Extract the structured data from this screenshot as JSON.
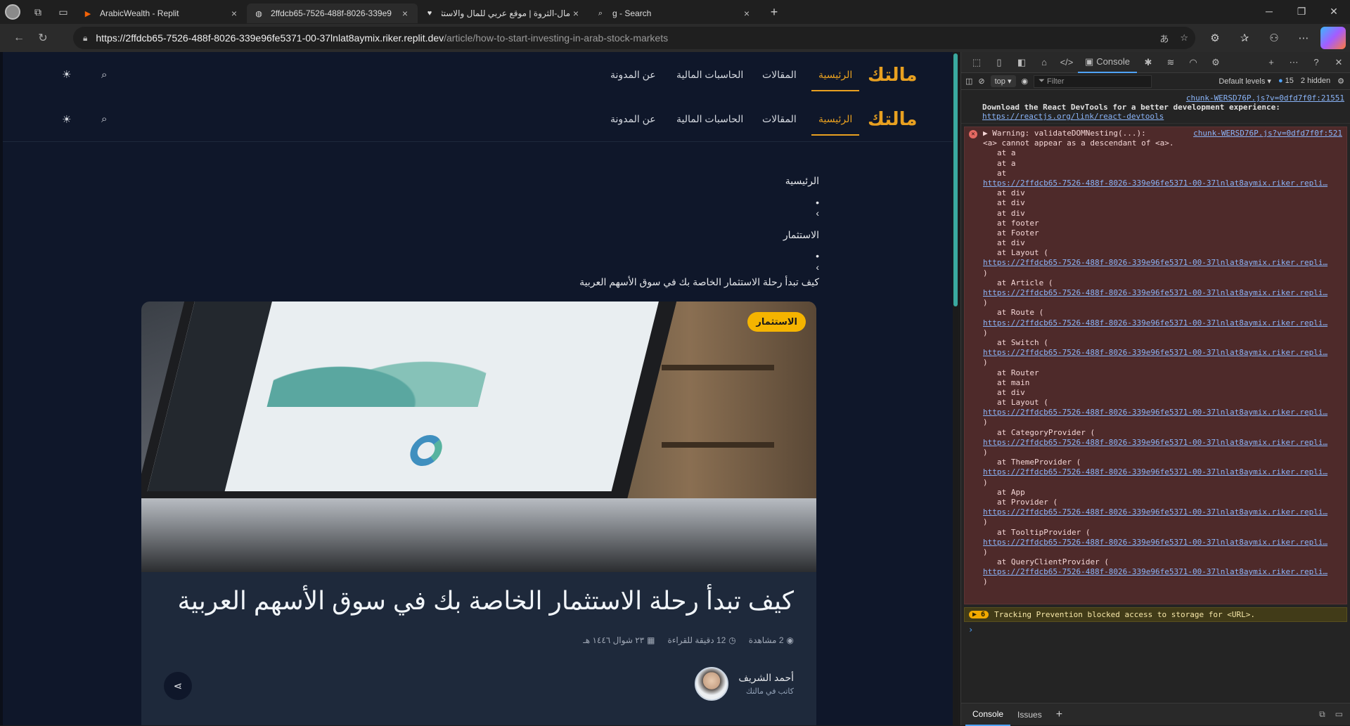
{
  "browser": {
    "tabs": [
      {
        "label": "ArabicWealth - Replit",
        "favicon": "replit-icon",
        "active": false
      },
      {
        "label": "2ffdcb65-7526-488f-8026-339e9",
        "favicon": "globe-icon",
        "active": true
      },
      {
        "label": "مال-الثروة | موقع عربي للمال والاستثمار",
        "favicon": "heart-icon",
        "active": false
      },
      {
        "label": "g - Search",
        "favicon": "search-icon",
        "active": false
      }
    ],
    "url_host": "https://2ffdcb65-7526-488f-8026-339e96fe5371-00-37lnlat8aymix.riker.replit.dev",
    "url_path": "/article/how-to-start-investing-in-arab-stock-markets"
  },
  "site": {
    "logo": "مالتك",
    "nav": [
      "الرئيسية",
      "المقالات",
      "الحاسبات المالية",
      "عن المدونة"
    ],
    "breadcrumb": [
      "الرئيسية",
      "•",
      "›",
      "الاستثمار",
      "•",
      "›",
      "كيف تبدأ رحلة الاستثمار الخاصة بك في سوق الأسهم العربية"
    ],
    "category_badge": "الاستثمار",
    "article_title": "كيف تبدأ رحلة الاستثمار الخاصة بك في سوق الأسهم العربية",
    "meta_date": "٢٣ شوال ١٤٤٦ هـ",
    "meta_read": "12 دقيقة للقراءة",
    "meta_views": "2 مشاهدة",
    "author_name": "أحمد الشريف",
    "author_role": "كاتب في مالتك"
  },
  "devtools": {
    "console_tab": "Console",
    "context": "top",
    "filter_placeholder": "Filter",
    "levels": "Default levels",
    "issues_count": "15",
    "hidden": "2 hidden",
    "info_src": "chunk-WERSD76P.js?v=0dfd7f0f:21551",
    "info_text": "Download the React DevTools for a better development experience:",
    "info_link": "https://reactjs.org/link/react-devtools",
    "error_src": "chunk-WERSD76P.js?v=0dfd7f0f:521",
    "error_head": "Warning: validateDOMNesting(...):",
    "error_body": "<a> cannot appear as a descendant of <a>.",
    "trace_url": "https://2ffdcb65-7526-488f-8026-339e96fe5371-00-37lnlat8aymix.riker.repli…",
    "stack": [
      "at a",
      "at a",
      "at",
      "@URL",
      "at div",
      "at div",
      "at div",
      "at footer",
      "at Footer",
      "at div",
      "at Layout (",
      "@URL",
      ")",
      "at Article (",
      "@URL",
      ")",
      "at Route (",
      "@URL",
      ")",
      "at Switch (",
      "@URL",
      ")",
      "at Router",
      "at main",
      "at div",
      "at Layout (",
      "@URL",
      ")",
      "at CategoryProvider (",
      "@URL",
      ")",
      "at ThemeProvider (",
      "@URL",
      ")",
      "at App",
      "at Provider (",
      "@URL",
      ")",
      "at TooltipProvider (",
      "@URL",
      ")",
      "at QueryClientProvider (",
      "@URL",
      ")"
    ],
    "warn_count": "6",
    "warn_text": "Tracking Prevention blocked access to storage for <URL>.",
    "bottom_tabs": [
      "Console",
      "Issues"
    ]
  }
}
